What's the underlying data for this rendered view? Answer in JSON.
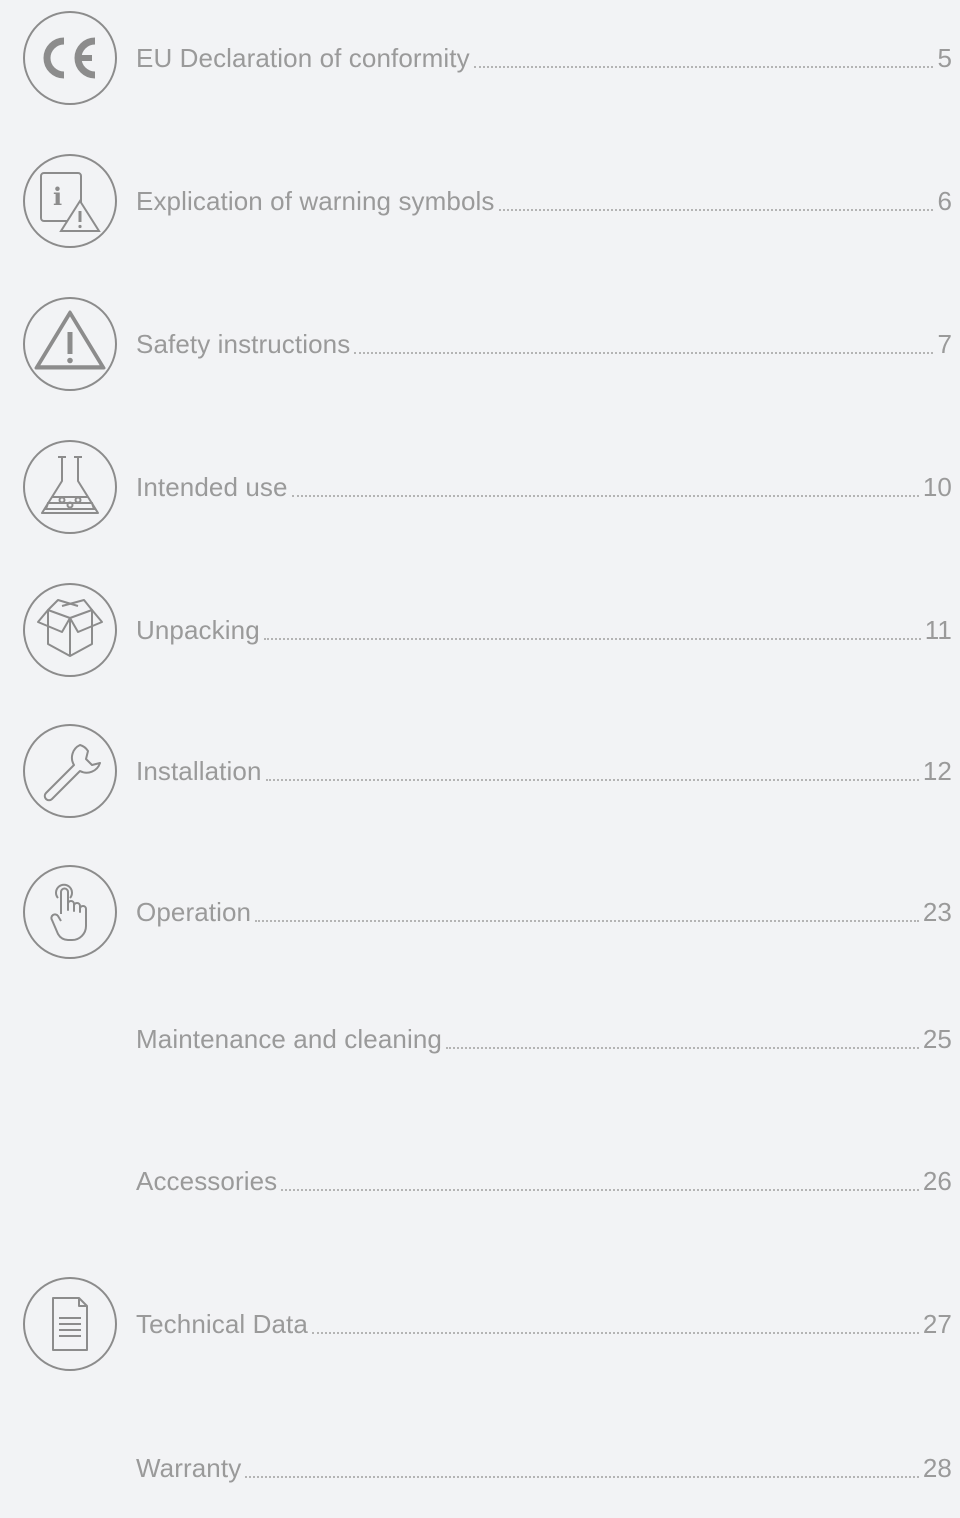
{
  "toc": {
    "items": [
      {
        "title": "EU Declaration of conformity",
        "page": "5",
        "icon": "ce-mark-icon"
      },
      {
        "title": "Explication of warning symbols",
        "page": "6",
        "icon": "info-warning-document-icon"
      },
      {
        "title": "Safety instructions",
        "page": "7",
        "icon": "warning-triangle-icon"
      },
      {
        "title": "Intended use",
        "page": "10",
        "icon": "lab-flask-icon"
      },
      {
        "title": "Unpacking",
        "page": "11",
        "icon": "open-box-icon"
      },
      {
        "title": "Installation",
        "page": "12",
        "icon": "wrench-icon"
      },
      {
        "title": "Operation",
        "page": "23",
        "icon": "pointing-finger-icon"
      },
      {
        "title": "Maintenance and cleaning",
        "page": "25",
        "icon": ""
      },
      {
        "title": "Accessories",
        "page": "26",
        "icon": ""
      },
      {
        "title": "Technical Data",
        "page": "27",
        "icon": "document-icon"
      },
      {
        "title": "Warranty",
        "page": "28",
        "icon": ""
      }
    ]
  },
  "colors": {
    "background": "#f2f3f5",
    "text": "#9a9a9a",
    "icon_stroke": "#8c8c8c"
  }
}
